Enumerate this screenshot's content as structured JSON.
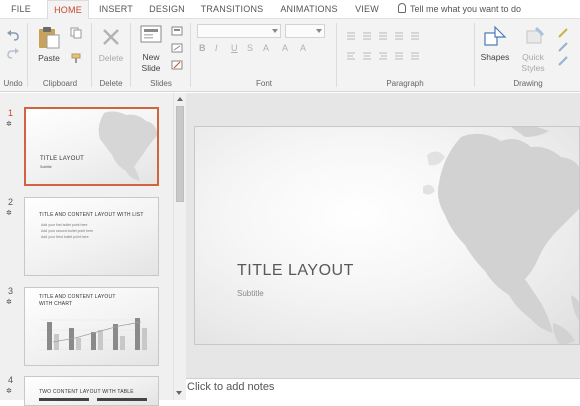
{
  "tabs": [
    {
      "label": "FILE"
    },
    {
      "label": "HOME"
    },
    {
      "label": "INSERT"
    },
    {
      "label": "DESIGN"
    },
    {
      "label": "TRANSITIONS"
    },
    {
      "label": "ANIMATIONS"
    },
    {
      "label": "VIEW"
    }
  ],
  "active_tab": "HOME",
  "tell_me": "Tell me what you want to do",
  "ribbon": {
    "groups": {
      "undo": "Undo",
      "clipboard": "Clipboard",
      "delete": "Delete",
      "slides": "Slides",
      "font": "Font",
      "paragraph": "Paragraph",
      "drawing": "Drawing"
    },
    "buttons": {
      "paste": "Paste",
      "delete": "Delete",
      "new_slide_1": "New",
      "new_slide_2": "Slide",
      "shapes": "Shapes",
      "quick_styles_1": "Quick",
      "quick_styles_2": "Styles"
    }
  },
  "slides": [
    {
      "number": "1",
      "title": "TITLE LAYOUT",
      "subtitle": "Subtitle"
    },
    {
      "number": "2",
      "title": "TITLE AND CONTENT LAYOUT WITH LIST",
      "bullets": [
        "Add your first bullet point here",
        "Add your second bullet point here",
        "Add your third bullet point here"
      ]
    },
    {
      "number": "3",
      "title_line1": "TITLE AND CONTENT LAYOUT",
      "title_line2": "WITH CHART"
    },
    {
      "number": "4",
      "title": "TWO CONTENT LAYOUT WITH TABLE"
    }
  ],
  "current_slide": {
    "title": "TITLE LAYOUT",
    "subtitle": "Subtitle"
  },
  "notes_placeholder": "Click to add notes",
  "colors": {
    "accent": "#c44a28",
    "selected_border": "#d2633f"
  }
}
